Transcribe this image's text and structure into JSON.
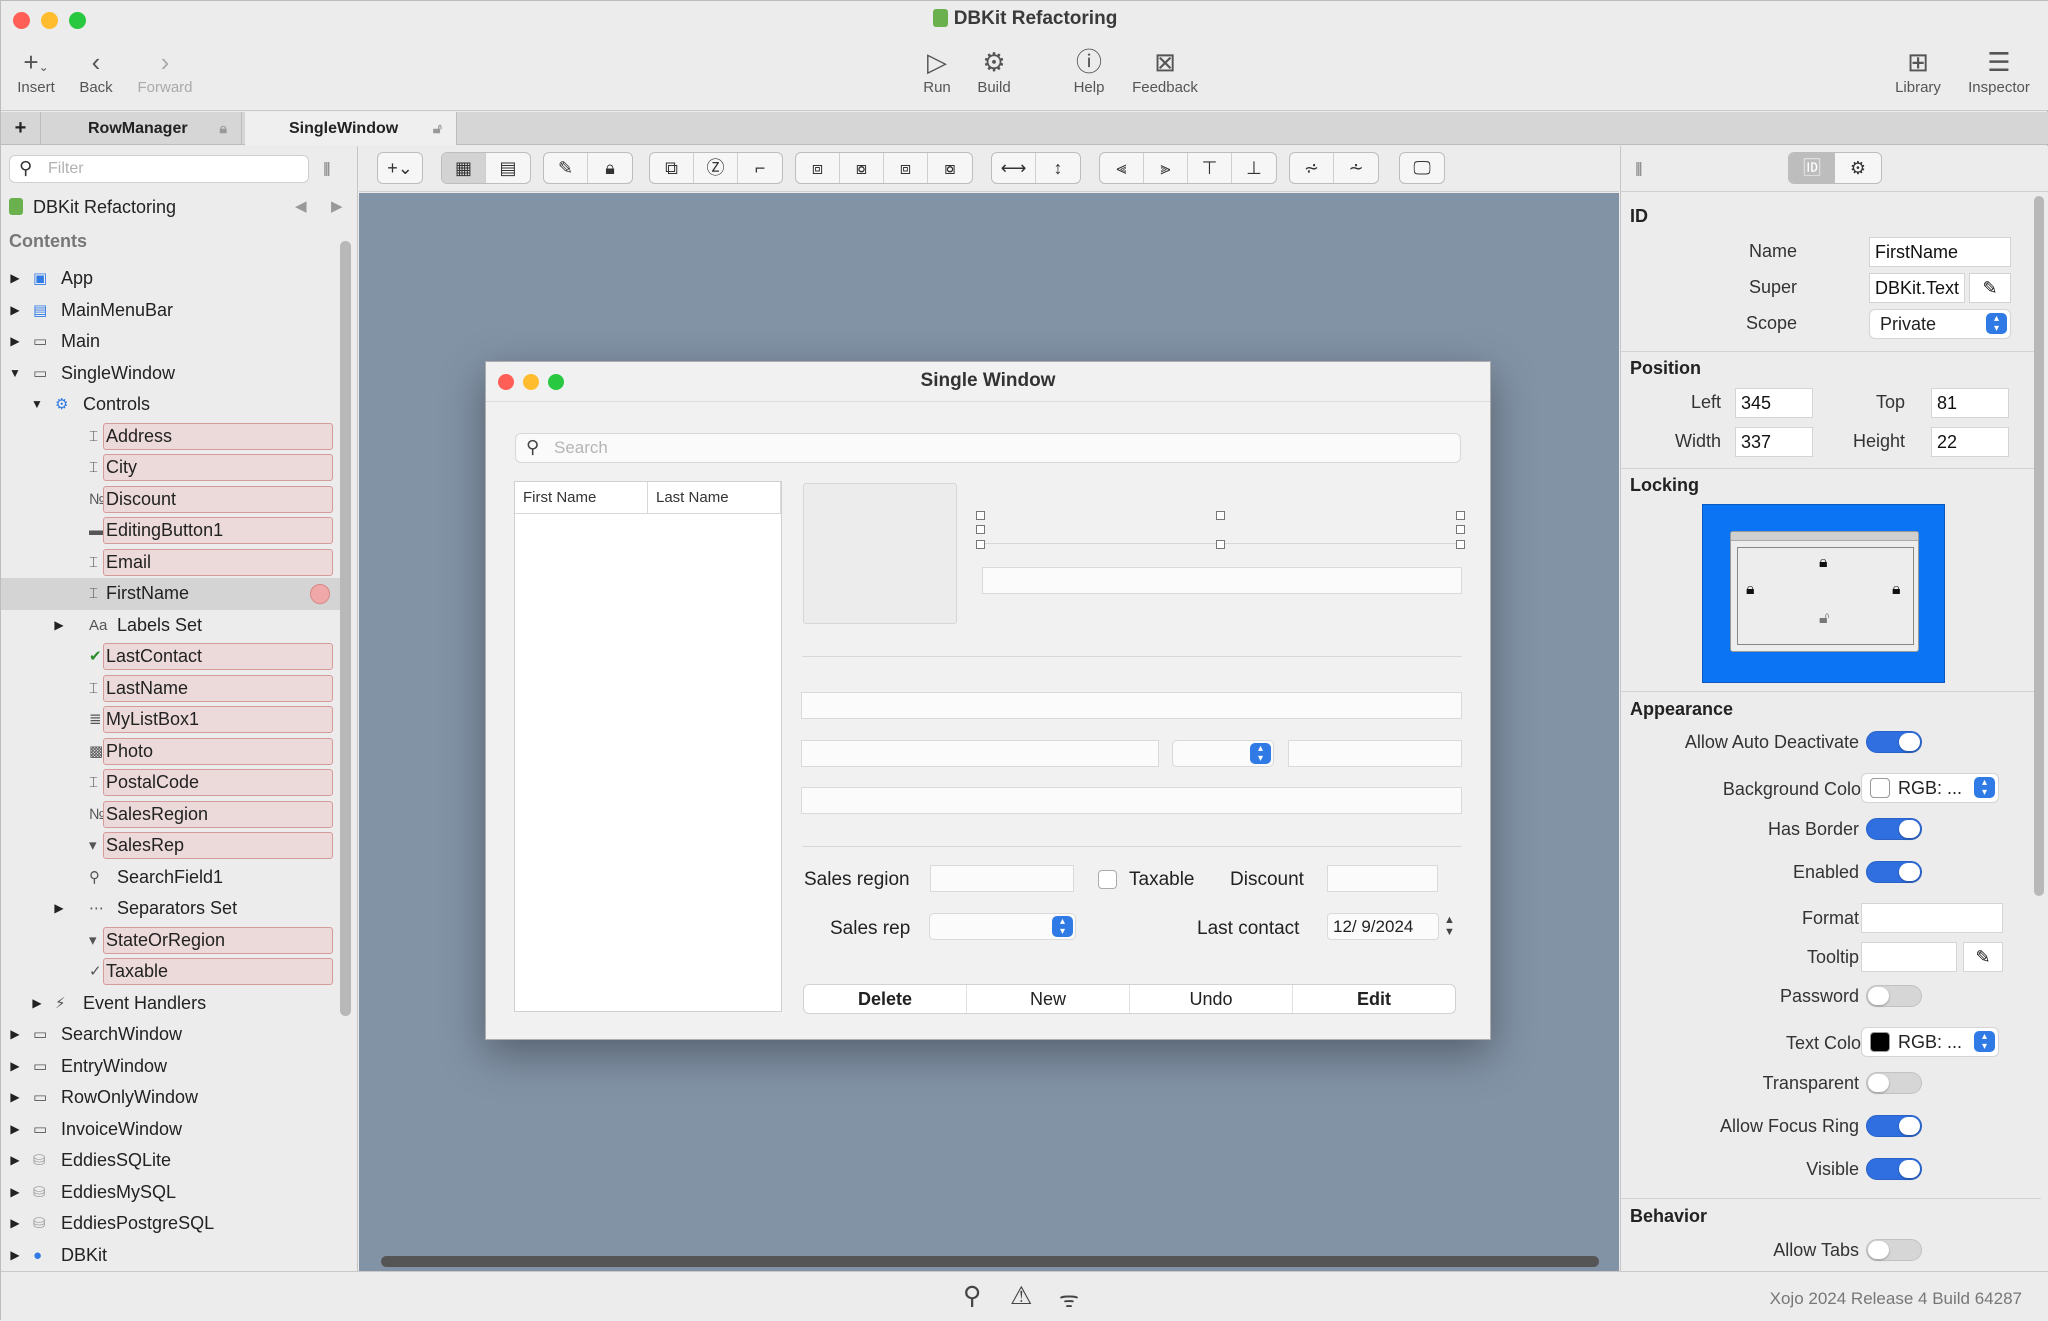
{
  "window": {
    "title": "DBKit Refactoring"
  },
  "toolbar": {
    "insert": "Insert",
    "back": "Back",
    "forward": "Forward",
    "run": "Run",
    "build": "Build",
    "help": "Help",
    "feedback": "Feedback",
    "library": "Library",
    "inspector": "Inspector"
  },
  "tabs": [
    {
      "label": "RowManager"
    },
    {
      "label": "SingleWindow"
    }
  ],
  "navigator": {
    "filter_placeholder": "Filter",
    "project": "DBKit Refactoring",
    "contents_header": "Contents",
    "items": [
      {
        "label": "App",
        "depth": 0,
        "expander": "closed",
        "icon": "app-icon"
      },
      {
        "label": "MainMenuBar",
        "depth": 0,
        "expander": "closed",
        "icon": "menubar-icon"
      },
      {
        "label": "Main",
        "depth": 0,
        "expander": "closed",
        "icon": "window-icon"
      },
      {
        "label": "SingleWindow",
        "depth": 0,
        "expander": "open",
        "icon": "window-icon"
      },
      {
        "label": "Controls",
        "depth": 1,
        "expander": "open",
        "icon": "controls-icon"
      },
      {
        "label": "Address",
        "depth": 2,
        "icon": "textfield-icon",
        "boxed": true
      },
      {
        "label": "City",
        "depth": 2,
        "icon": "textfield-icon",
        "boxed": true
      },
      {
        "label": "Discount",
        "depth": 2,
        "icon": "numberfield-icon",
        "boxed": true
      },
      {
        "label": "EditingButton1",
        "depth": 2,
        "icon": "segmented-icon",
        "boxed": true
      },
      {
        "label": "Email",
        "depth": 2,
        "icon": "textfield-icon",
        "boxed": true
      },
      {
        "label": "FirstName",
        "depth": 2,
        "icon": "textfield-icon",
        "boxed": true,
        "selected": true
      },
      {
        "label": "Labels Set",
        "depth": 2,
        "expander": "closed",
        "icon": "label-icon"
      },
      {
        "label": "LastContact",
        "depth": 2,
        "icon": "datepicker-icon",
        "boxed": true
      },
      {
        "label": "LastName",
        "depth": 2,
        "icon": "textfield-icon",
        "boxed": true
      },
      {
        "label": "MyListBox1",
        "depth": 2,
        "icon": "listbox-icon",
        "boxed": true
      },
      {
        "label": "Photo",
        "depth": 2,
        "icon": "canvas-icon",
        "boxed": true
      },
      {
        "label": "PostalCode",
        "depth": 2,
        "icon": "textfield-icon",
        "boxed": true
      },
      {
        "label": "SalesRegion",
        "depth": 2,
        "icon": "numberfield-icon",
        "boxed": true
      },
      {
        "label": "SalesRep",
        "depth": 2,
        "icon": "popup-icon",
        "boxed": true
      },
      {
        "label": "SearchField1",
        "depth": 2,
        "icon": "searchfield-icon"
      },
      {
        "label": "Separators Set",
        "depth": 2,
        "expander": "closed",
        "icon": "separator-icon"
      },
      {
        "label": "StateOrRegion",
        "depth": 2,
        "icon": "popup-icon",
        "boxed": true
      },
      {
        "label": "Taxable",
        "depth": 2,
        "icon": "checkbox-icon",
        "boxed": true
      },
      {
        "label": "Event Handlers",
        "depth": 1,
        "expander": "closed",
        "icon": "event-icon"
      },
      {
        "label": "SearchWindow",
        "depth": 0,
        "expander": "closed",
        "icon": "window-icon"
      },
      {
        "label": "EntryWindow",
        "depth": 0,
        "expander": "closed",
        "icon": "window-icon"
      },
      {
        "label": "RowOnlyWindow",
        "depth": 0,
        "expander": "closed",
        "icon": "window-icon"
      },
      {
        "label": "InvoiceWindow",
        "depth": 0,
        "expander": "closed",
        "icon": "window-icon"
      },
      {
        "label": "EddiesSQLite",
        "depth": 0,
        "expander": "closed",
        "icon": "database-icon"
      },
      {
        "label": "EddiesMySQL",
        "depth": 0,
        "expander": "closed",
        "icon": "database-icon"
      },
      {
        "label": "EddiesPostgreSQL",
        "depth": 0,
        "expander": "closed",
        "icon": "database-icon"
      },
      {
        "label": "DBKit",
        "depth": 0,
        "expander": "closed",
        "icon": "globe-icon"
      }
    ]
  },
  "designer": {
    "window_title": "Single Window",
    "search_placeholder": "Search",
    "list_columns": [
      "First Name",
      "Last Name"
    ],
    "sales_region_label": "Sales region",
    "taxable_label": "Taxable",
    "discount_label": "Discount",
    "sales_rep_label": "Sales rep",
    "last_contact_label": "Last contact",
    "last_contact_value": "12/ 9/2024",
    "segments": [
      "Delete",
      "New",
      "Undo",
      "Edit"
    ]
  },
  "inspector": {
    "id_header": "ID",
    "name_label": "Name",
    "name_value": "FirstName",
    "super_label": "Super",
    "super_value": "DBKit.Text",
    "scope_label": "Scope",
    "scope_value": "Private",
    "position_header": "Position",
    "left_label": "Left",
    "left_value": "345",
    "top_label": "Top",
    "top_value": "81",
    "width_label": "Width",
    "width_value": "337",
    "height_label": "Height",
    "height_value": "22",
    "locking_header": "Locking",
    "appearance_header": "Appearance",
    "allow_auto_deactivate_label": "Allow Auto Deactivate",
    "background_color_label": "Background Color",
    "background_color_value": "RGB: ...",
    "has_border_label": "Has Border",
    "enabled_label": "Enabled",
    "format_label": "Format",
    "tooltip_label": "Tooltip",
    "password_label": "Password",
    "text_color_label": "Text Color",
    "text_color_value": "RGB: ...",
    "transparent_label": "Transparent",
    "allow_focus_ring_label": "Allow Focus Ring",
    "visible_label": "Visible",
    "behavior_header": "Behavior",
    "allow_tabs_label": "Allow Tabs",
    "toggles": {
      "allow_auto_deactivate": true,
      "has_border": true,
      "enabled": true,
      "password": false,
      "transparent": false,
      "allow_focus_ring": true,
      "visible": true,
      "allow_tabs": false
    }
  },
  "status": {
    "version": "Xojo 2024 Release 4 Build 64287"
  },
  "colors": {
    "accent": "#2f6fdf",
    "canvas": "#8293a6",
    "lock_box": "#0a74f5",
    "boxed_row": "#ecd9d9"
  }
}
